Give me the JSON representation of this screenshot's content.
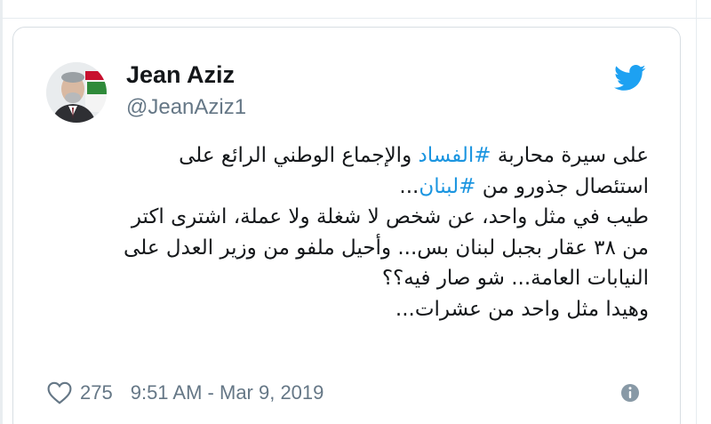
{
  "tweet": {
    "author": {
      "display_name": "Jean Aziz",
      "handle": "@JeanAziz1"
    },
    "text": {
      "line1_before": "على سيرة محاربة ",
      "line1_hashtag": "#الفساد",
      "line1_after": " والإجماع الوطني الرائع على",
      "line2_before": "استئصال جذورو من ",
      "line2_hashtag": "#لبنان",
      "line2_after": "...",
      "line3": "طيب في مثل واحد، عن شخص لا شغلة ولا عملة، اشترى اكتر",
      "line4": "من ٣٨ عقار بجبل لبنان بس... وأحيل ملفو من وزير العدل على",
      "line5": "النيابات العامة... شو صار فيه؟؟",
      "line6": "وهيدا مثل واحد من عشرات..."
    },
    "likes": "275",
    "timestamp": "9:51 AM - Mar 9, 2019"
  },
  "icons": {
    "brand": "twitter-bird-icon",
    "like": "heart-icon",
    "info": "info-icon"
  },
  "colors": {
    "hashtag": "#1b95e0",
    "twitter_blue": "#1da1f2",
    "text": "#14171a",
    "muted": "#657786",
    "border": "#d8dee3"
  }
}
